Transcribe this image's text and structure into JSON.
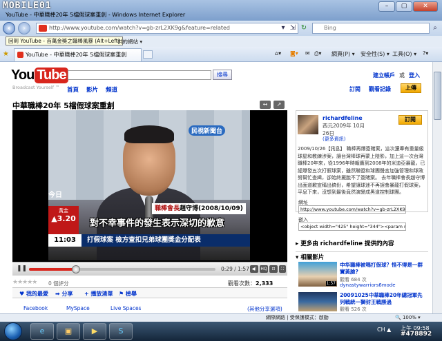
{
  "window": {
    "watermark_logo": "MOBILE01",
    "title": "YouTube - 中華職棒20年 5檔假球案重創 - Windows Internet Explorer",
    "buttons": {
      "minimize": "–",
      "maximize": "▢",
      "close": "✕"
    }
  },
  "address_bar": {
    "url": "http://www.youtube.com/watch?v=gb-zrL2XK9g&feature=related",
    "search_placeholder": "Bing",
    "tooltip": "回到 YouTube - 百萬金獎之職棒風暴 (Alt+Left)",
    "favorites_tail": "供的網站 ▾"
  },
  "tabs": {
    "active_tab": "YouTube - 中華職棒20年 5檔假球案重創",
    "tools": {
      "page": "網頁(P) ▾",
      "safety": "安全性(S) ▾",
      "tools": "工具(O) ▾",
      "help": "?▾"
    }
  },
  "youtube": {
    "logo_you": "You",
    "logo_tube": "Tube",
    "broadcast": "Broadcast Yourself ™",
    "search_button": "搜尋",
    "nav": {
      "home": "首頁",
      "videos": "影片",
      "channels": "頻道"
    },
    "top_links": {
      "signup": "建立帳戶",
      "or": "或",
      "login": "登入"
    },
    "user_links": {
      "subscriptions": "訂閱",
      "history": "觀看記錄",
      "upload": "上傳"
    }
  },
  "video": {
    "title": "中華職棒20年 5檔假球案重創",
    "tv_logo": "民視新聞台",
    "jin": "今日",
    "gold_label": "黃金",
    "gold_value": "▲3.20",
    "label_name": "職棒會長",
    "label_person": "趙守博(2008/10/09)",
    "caption": "對不幸事件的發生表示深切的歉意",
    "clock": "11:03",
    "ticker": "打假球案  檢方查扣兄弟球團獎金分配表",
    "time": "0:29 / 1:57",
    "hq": "HQ",
    "progress": 0.25
  },
  "stats": {
    "stars": "★★★★★",
    "ratings": "0 個評分",
    "views_label": "觀看次數：",
    "views_value": "2,333"
  },
  "actions": {
    "favorite": "♥ 我的最愛",
    "share": "➡ 分享",
    "playlist": "+ 播放清單",
    "flag": "⚑ 檢舉"
  },
  "share_sites": {
    "facebook": "Facebook",
    "myspace": "MySpace",
    "livespaces": "Live Spaces",
    "more": "(其他分享選項)"
  },
  "channel": {
    "name": "richardfeline",
    "date": "西元2009年 10月26日",
    "more": "(更多資訊)",
    "subscribe": "訂閱",
    "description": "2009/10/26【訊息】 職棒再爆簽賭案，這次還牽有重量級球星和教練涉案，讓台灣棒球再蒙上陰影，加上這一次台灣職棒20年來，從1996年時報鷹到2008年的米迪亞暴龍，已經爆發五次打假球案，雖然聯盟和球團聲言加強管理和球政努幫忙查緝，卻始終擺脫不了簽賭案。 去年職棒會長趙守博出面道歉宣稱出搞份，希望讓球迷不再誤會暴龍打假球案，平息下來，沒想到最後竟然演變成黑道控制球團。",
    "url_label": "網址",
    "url": "http://www.youtube.com/watch?v=gb-zrL2XK9g",
    "embed_label": "嵌入",
    "embed": "<object width=\"425\" height=\"344\"><param name=\"m"
  },
  "more_from": "▸ 更多由 richardfeline 提供的內容",
  "related": {
    "heading": "▾ 相關影片",
    "items": [
      {
        "title": "中华職棒被嗎打假球？怪不得是一群實黃臉?",
        "views": "觀看 684 次",
        "user": "dynastywarriors6mode",
        "duration": "1:57"
      },
      {
        "title": "20091025中華職棒20年總冠軍先列戰統一獅封王戰勝過",
        "views": "觀看 526 次",
        "user": "",
        "duration": ""
      }
    ]
  },
  "status_bar": {
    "zone": "網際網路 | 受保護模式：啟動",
    "zoom": "🔍 100% ▾"
  },
  "taskbar": {
    "lang": "CH ▲",
    "time": "上午 09:58",
    "image_id": "#478892"
  }
}
